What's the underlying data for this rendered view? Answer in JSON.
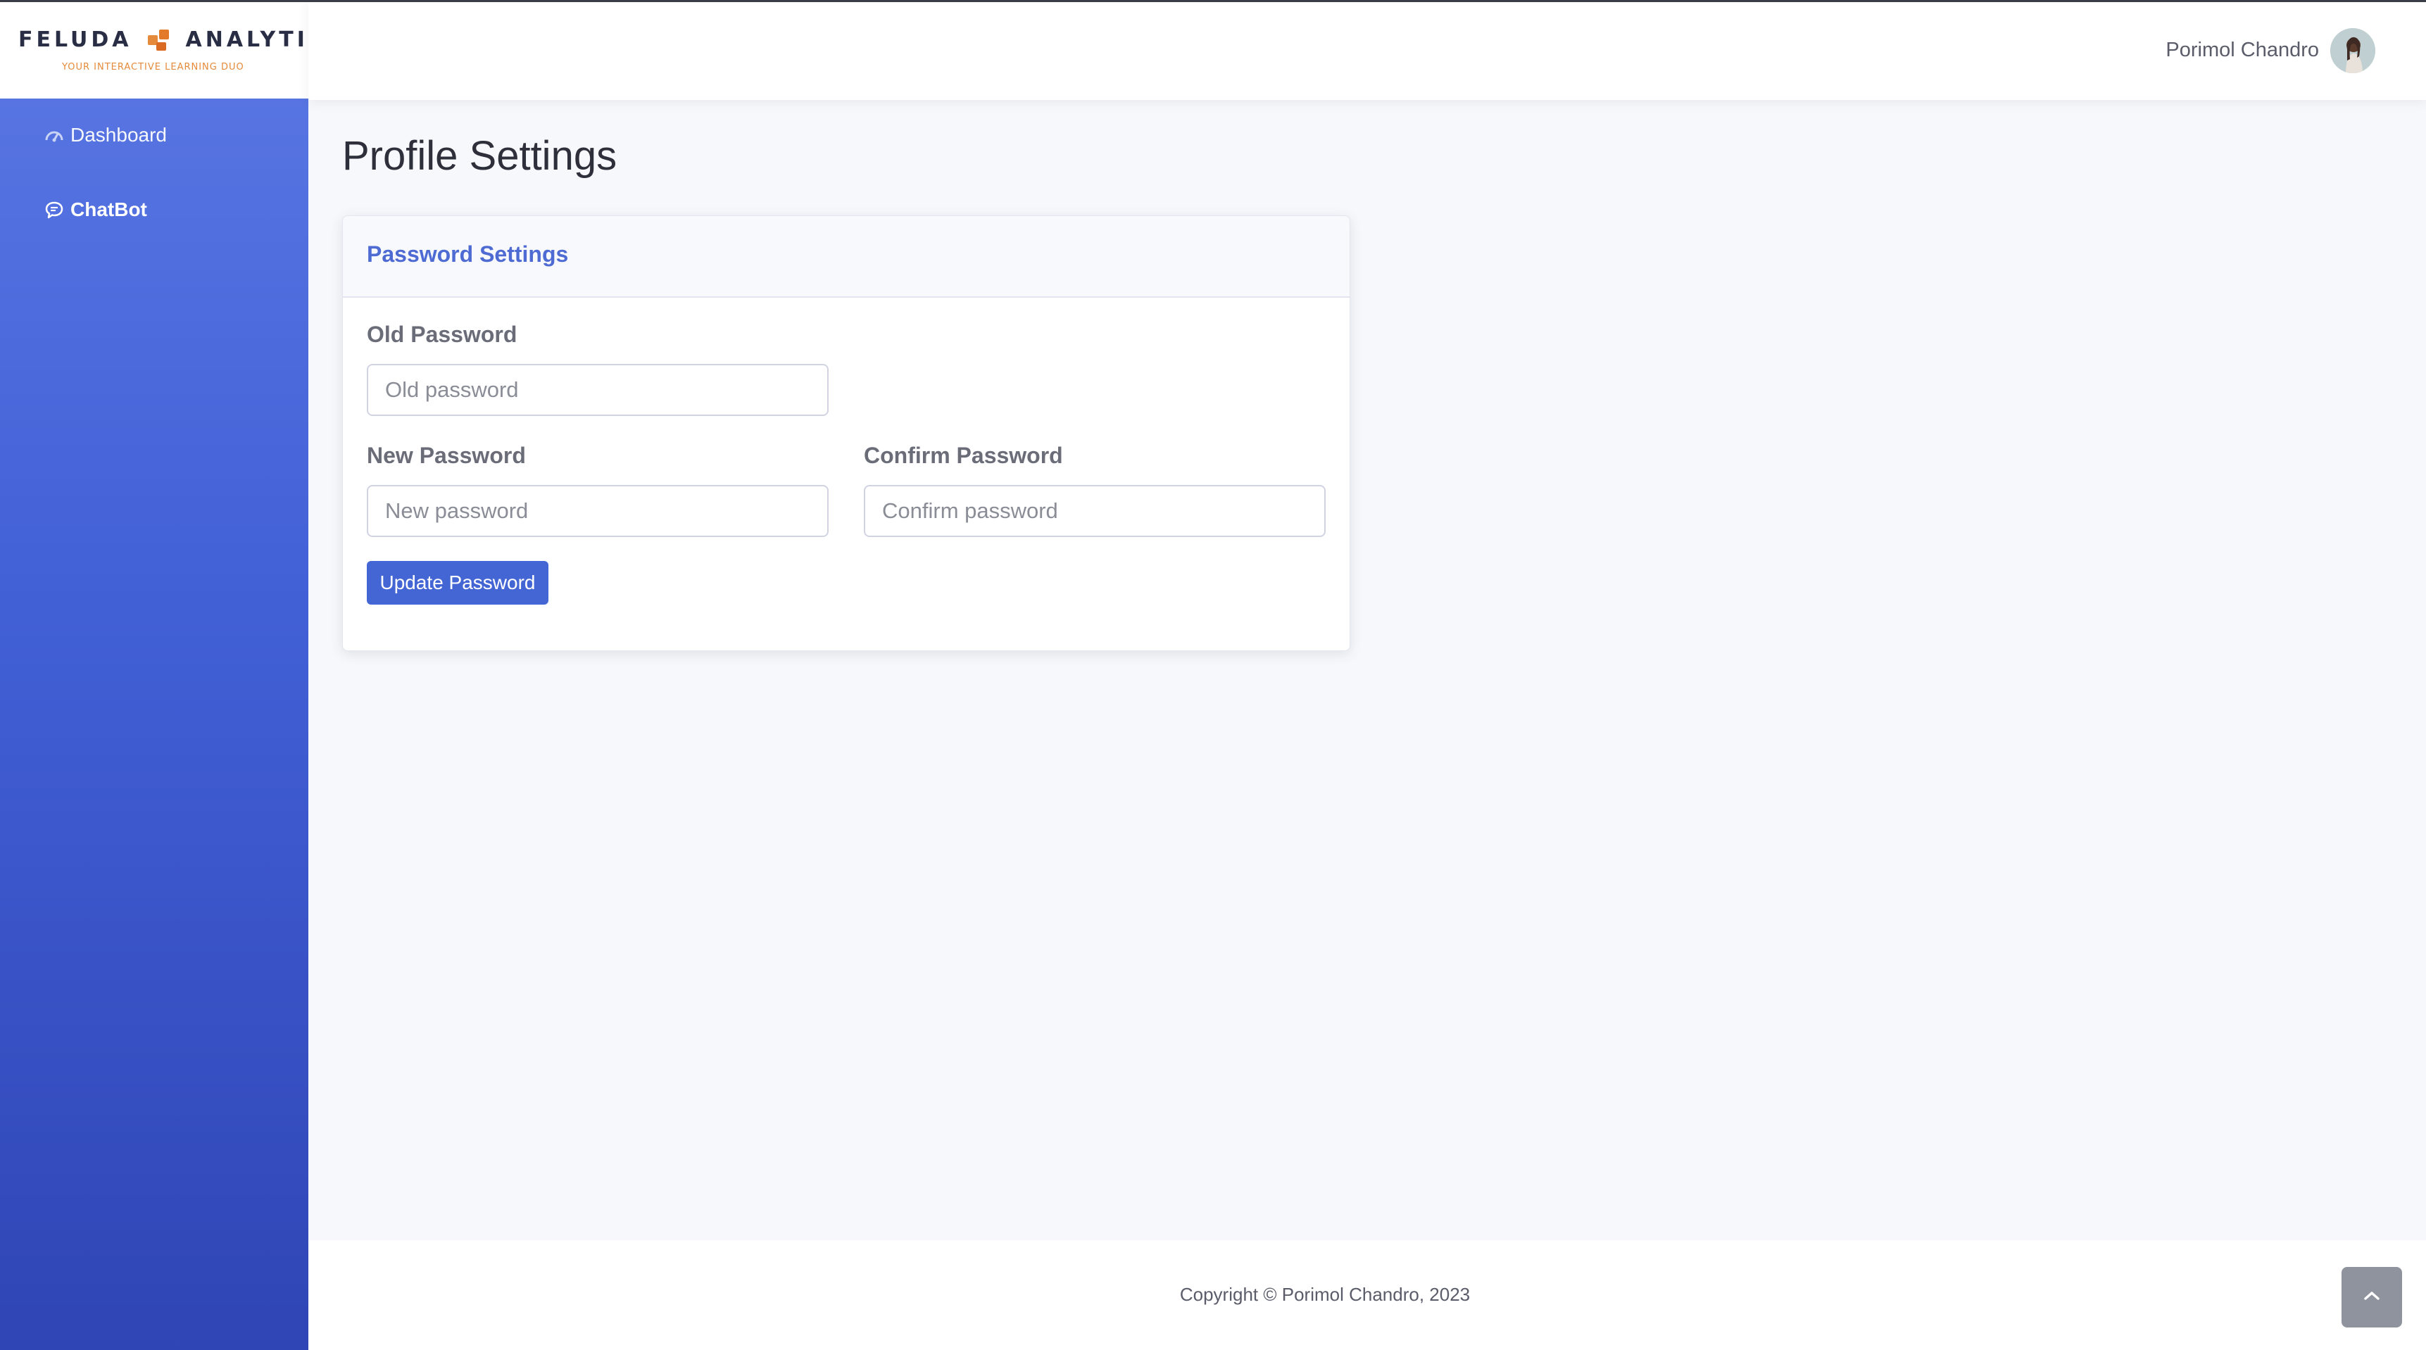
{
  "brand": {
    "word_left": "FELUDA",
    "word_right": "ANALYTICA",
    "tagline": "YOUR INTERACTIVE LEARNING DUO"
  },
  "sidebar": {
    "items": [
      {
        "label": "Dashboard",
        "icon": "dashboard-gauge-icon"
      },
      {
        "label": "ChatBot",
        "icon": "chat-bubble-icon"
      }
    ]
  },
  "header": {
    "user_name": "Porimol Chandro",
    "avatar": "user-avatar"
  },
  "main": {
    "page_title": "Profile Settings",
    "card": {
      "title": "Password Settings",
      "old_password": {
        "label": "Old Password",
        "placeholder": "Old password",
        "value": ""
      },
      "new_password": {
        "label": "New Password",
        "placeholder": "New password",
        "value": ""
      },
      "confirm_password": {
        "label": "Confirm Password",
        "placeholder": "Confirm password",
        "value": ""
      },
      "submit_label": "Update Password"
    }
  },
  "footer": {
    "copyright": "Copyright © Porimol Chandro, 2023",
    "scroll_top_icon": "chevron-up-icon"
  },
  "colors": {
    "accent": "#4466d4",
    "sidebar_top": "#5b78e4",
    "sidebar_bottom": "#2f45b5",
    "brand_orange": "#e58a3a"
  }
}
